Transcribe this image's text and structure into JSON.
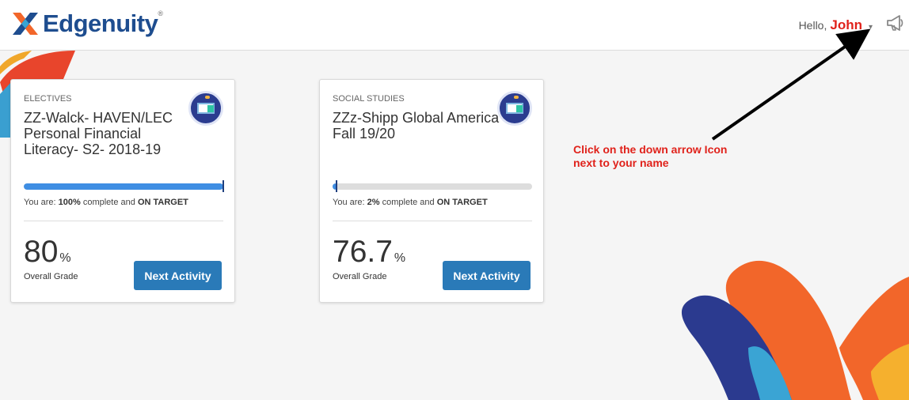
{
  "brand": {
    "name": "Edgenuity",
    "tm": "®"
  },
  "header": {
    "greeting": "Hello,",
    "user_name": "John",
    "caret": "▾"
  },
  "courses": [
    {
      "subject": "ELECTIVES",
      "title": "ZZ-Walck- HAVEN/LEC Personal Financial Literacy- S2- 2018-19",
      "progress_percent": 100,
      "status_prefix": "You are: ",
      "status_percent": "100%",
      "status_mid": " complete and ",
      "status_target": "ON TARGET",
      "grade": "80",
      "grade_unit": "%",
      "grade_label": "Overall Grade",
      "button_label": "Next Activity"
    },
    {
      "subject": "SOCIAL STUDIES",
      "title": "ZZz-Shipp Global America Fall 19/20",
      "progress_percent": 2,
      "status_prefix": "You are: ",
      "status_percent": "2%",
      "status_mid": " complete and ",
      "status_target": "ON TARGET",
      "grade": "76.7",
      "grade_unit": "%",
      "grade_label": "Overall Grade",
      "button_label": "Next Activity"
    }
  ],
  "annotation": {
    "text": "Click on the down arrow Icon next to your name",
    "color": "#e0221b"
  },
  "colors": {
    "brand_blue": "#1e4d8f",
    "progress_fill": "#3f8ee3",
    "button": "#2a7ab8",
    "name_red": "#e0221b"
  },
  "icons": [
    "edgenuity-logo-icon",
    "chevron-down-icon",
    "megaphone-icon",
    "course-icon"
  ]
}
